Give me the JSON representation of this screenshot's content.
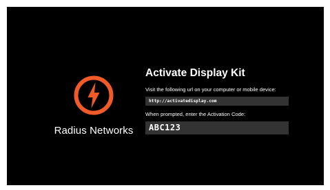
{
  "brand": {
    "name": "Radius Networks",
    "logo_icon": "lightning-bolt-icon",
    "accent_color": "#f15a29"
  },
  "activation": {
    "title": "Activate Display Kit",
    "url_instruction": "Visit the following url on your computer or mobile device:",
    "url": "http://activatedisplay.com",
    "code_instruction": "When prompted, enter the Activation Code:",
    "code": "ABC123"
  },
  "colors": {
    "background": "#000000",
    "field_background": "#333333",
    "text": "#ffffff"
  }
}
